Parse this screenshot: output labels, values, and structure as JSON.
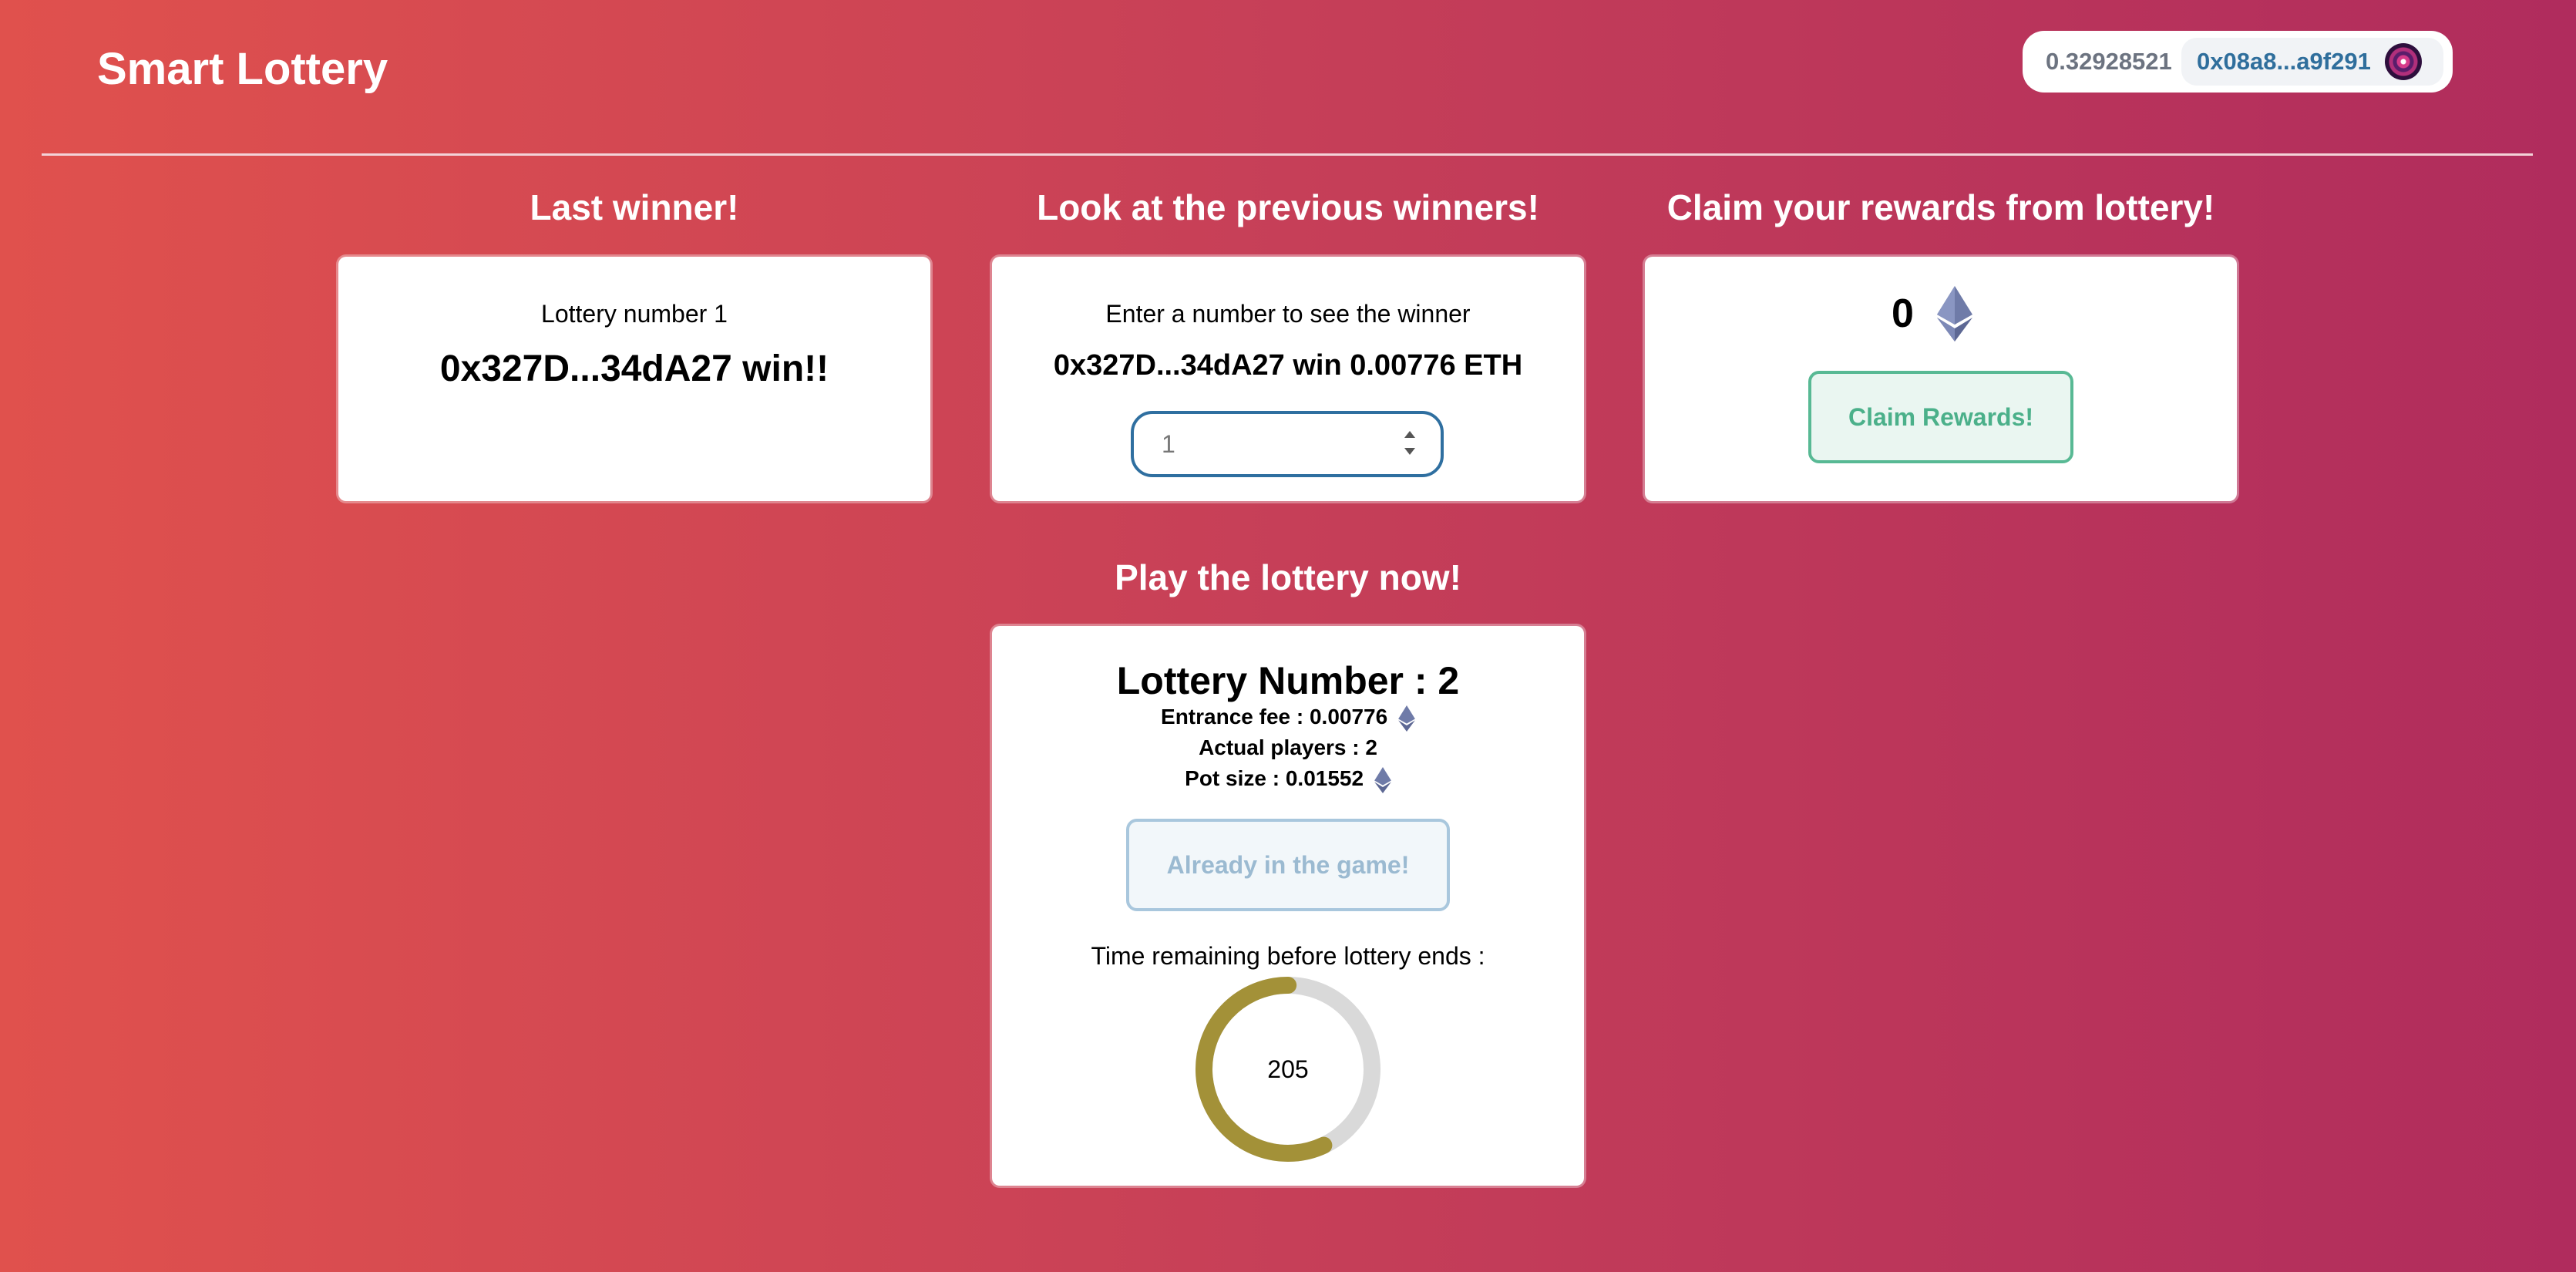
{
  "header": {
    "app_title": "Smart Lottery",
    "wallet_balance": "0.32928521",
    "wallet_address": "0x08a8...a9f291"
  },
  "last_winner": {
    "title": "Last winner!",
    "lottery_label": "Lottery number 1",
    "winner_text": "0x327D...34dA27 win!!"
  },
  "previous_winners": {
    "title": "Look at the previous winners!",
    "prompt": "Enter a number to see the winner",
    "result": "0x327D...34dA27 win 0.00776 ETH",
    "input_value": "1"
  },
  "claim": {
    "title": "Claim your rewards from lottery!",
    "amount": "0",
    "button_label": "Claim Rewards!"
  },
  "play": {
    "title": "Play the lottery now!",
    "lottery_number": "Lottery Number : 2",
    "entrance_fee": "Entrance fee : 0.00776",
    "actual_players": "Actual players : 2",
    "pot_size": "Pot size : 0.01552",
    "button_label": "Already in the game!",
    "time_label": "Time remaining before lottery ends :",
    "time_remaining": "205",
    "time_progress_fraction": 0.57
  },
  "colors": {
    "progress": "#a39138",
    "progress_track": "#d9d9d9",
    "eth_icon": "#6f7ba8"
  },
  "icons": {
    "eth": "ethereum-icon",
    "avatar": "avatar"
  }
}
